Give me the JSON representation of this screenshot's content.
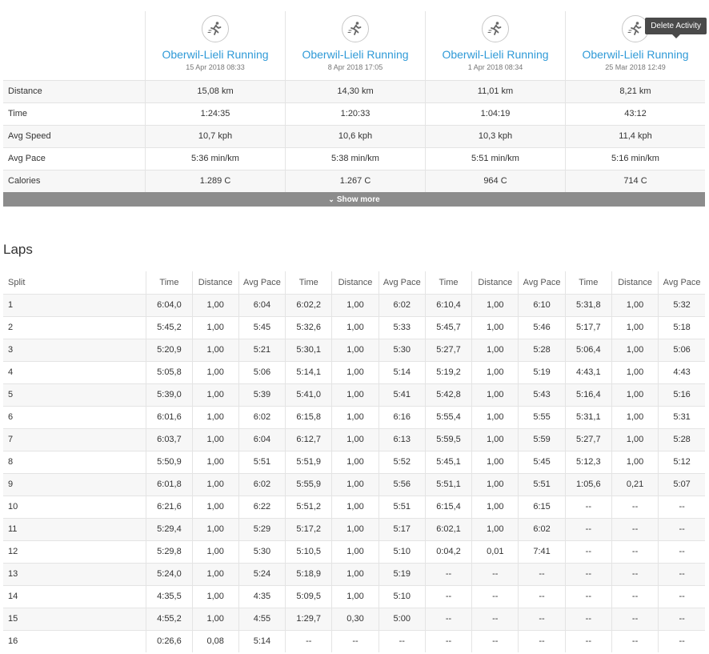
{
  "tooltip": "Delete Activity",
  "activities": [
    {
      "title": "Oberwil-Lieli Running",
      "date": "15 Apr 2018 08:33",
      "icon": "running-icon"
    },
    {
      "title": "Oberwil-Lieli Running",
      "date": "8 Apr 2018 17:05",
      "icon": "running-icon"
    },
    {
      "title": "Oberwil-Lieli Running",
      "date": "1 Apr 2018 08:34",
      "icon": "running-icon"
    },
    {
      "title": "Oberwil-Lieli Running",
      "date": "25 Mar 2018 12:49",
      "icon": "running-icon"
    }
  ],
  "summary_rows": [
    {
      "label": "Distance",
      "values": [
        "15,08 km",
        "14,30 km",
        "11,01 km",
        "8,21 km"
      ]
    },
    {
      "label": "Time",
      "values": [
        "1:24:35",
        "1:20:33",
        "1:04:19",
        "43:12"
      ]
    },
    {
      "label": "Avg Speed",
      "values": [
        "10,7 kph",
        "10,6 kph",
        "10,3 kph",
        "11,4 kph"
      ]
    },
    {
      "label": "Avg Pace",
      "values": [
        "5:36 min/km",
        "5:38 min/km",
        "5:51 min/km",
        "5:16 min/km"
      ]
    },
    {
      "label": "Calories",
      "values": [
        "1.289 C",
        "1.267 C",
        "964 C",
        "714 C"
      ]
    }
  ],
  "show_more_label": "Show more",
  "laps": {
    "title": "Laps",
    "split_header": "Split",
    "col_headers": [
      "Time",
      "Distance",
      "Avg Pace"
    ],
    "rows": [
      [
        "1",
        "6:04,0",
        "1,00",
        "6:04",
        "6:02,2",
        "1,00",
        "6:02",
        "6:10,4",
        "1,00",
        "6:10",
        "5:31,8",
        "1,00",
        "5:32"
      ],
      [
        "2",
        "5:45,2",
        "1,00",
        "5:45",
        "5:32,6",
        "1,00",
        "5:33",
        "5:45,7",
        "1,00",
        "5:46",
        "5:17,7",
        "1,00",
        "5:18"
      ],
      [
        "3",
        "5:20,9",
        "1,00",
        "5:21",
        "5:30,1",
        "1,00",
        "5:30",
        "5:27,7",
        "1,00",
        "5:28",
        "5:06,4",
        "1,00",
        "5:06"
      ],
      [
        "4",
        "5:05,8",
        "1,00",
        "5:06",
        "5:14,1",
        "1,00",
        "5:14",
        "5:19,2",
        "1,00",
        "5:19",
        "4:43,1",
        "1,00",
        "4:43"
      ],
      [
        "5",
        "5:39,0",
        "1,00",
        "5:39",
        "5:41,0",
        "1,00",
        "5:41",
        "5:42,8",
        "1,00",
        "5:43",
        "5:16,4",
        "1,00",
        "5:16"
      ],
      [
        "6",
        "6:01,6",
        "1,00",
        "6:02",
        "6:15,8",
        "1,00",
        "6:16",
        "5:55,4",
        "1,00",
        "5:55",
        "5:31,1",
        "1,00",
        "5:31"
      ],
      [
        "7",
        "6:03,7",
        "1,00",
        "6:04",
        "6:12,7",
        "1,00",
        "6:13",
        "5:59,5",
        "1,00",
        "5:59",
        "5:27,7",
        "1,00",
        "5:28"
      ],
      [
        "8",
        "5:50,9",
        "1,00",
        "5:51",
        "5:51,9",
        "1,00",
        "5:52",
        "5:45,1",
        "1,00",
        "5:45",
        "5:12,3",
        "1,00",
        "5:12"
      ],
      [
        "9",
        "6:01,8",
        "1,00",
        "6:02",
        "5:55,9",
        "1,00",
        "5:56",
        "5:51,1",
        "1,00",
        "5:51",
        "1:05,6",
        "0,21",
        "5:07"
      ],
      [
        "10",
        "6:21,6",
        "1,00",
        "6:22",
        "5:51,2",
        "1,00",
        "5:51",
        "6:15,4",
        "1,00",
        "6:15",
        "--",
        "--",
        "--"
      ],
      [
        "11",
        "5:29,4",
        "1,00",
        "5:29",
        "5:17,2",
        "1,00",
        "5:17",
        "6:02,1",
        "1,00",
        "6:02",
        "--",
        "--",
        "--"
      ],
      [
        "12",
        "5:29,8",
        "1,00",
        "5:30",
        "5:10,5",
        "1,00",
        "5:10",
        "0:04,2",
        "0,01",
        "7:41",
        "--",
        "--",
        "--"
      ],
      [
        "13",
        "5:24,0",
        "1,00",
        "5:24",
        "5:18,9",
        "1,00",
        "5:19",
        "--",
        "--",
        "--",
        "--",
        "--",
        "--"
      ],
      [
        "14",
        "4:35,5",
        "1,00",
        "4:35",
        "5:09,5",
        "1,00",
        "5:10",
        "--",
        "--",
        "--",
        "--",
        "--",
        "--"
      ],
      [
        "15",
        "4:55,2",
        "1,00",
        "4:55",
        "1:29,7",
        "0,30",
        "5:00",
        "--",
        "--",
        "--",
        "--",
        "--",
        "--"
      ],
      [
        "16",
        "0:26,6",
        "0,08",
        "5:14",
        "--",
        "--",
        "--",
        "--",
        "--",
        "--",
        "--",
        "--",
        "--"
      ]
    ]
  }
}
